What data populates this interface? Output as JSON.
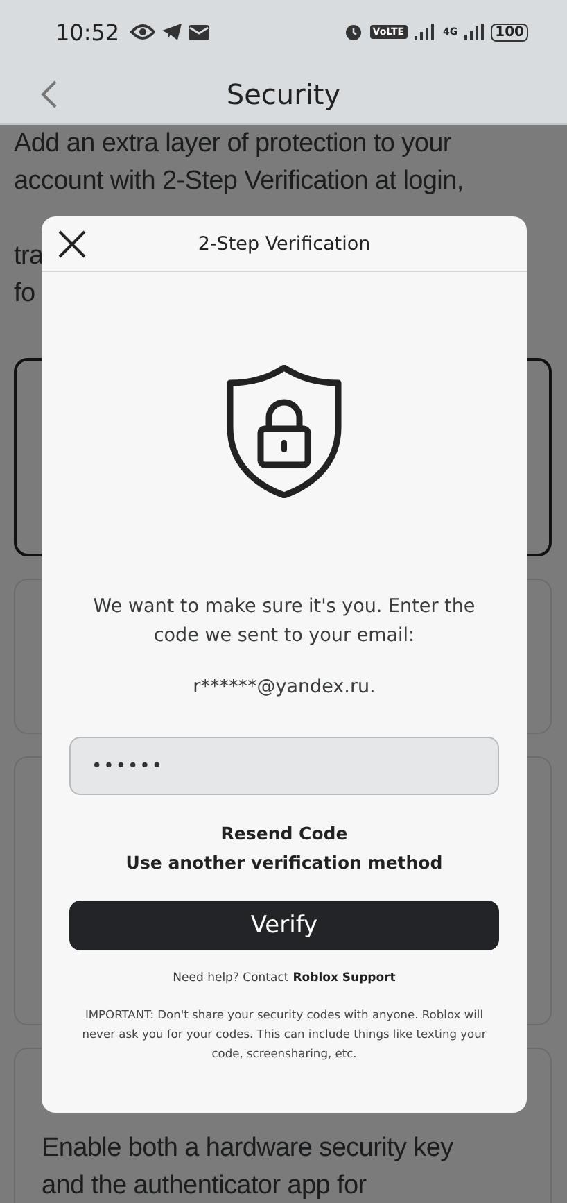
{
  "status_bar": {
    "time": "10:52",
    "volte": "VoLTE",
    "network": "4G",
    "battery": "100"
  },
  "header": {
    "title": "Security"
  },
  "page": {
    "description_lines": [
      "Add an extra layer of protection to your",
      "account with 2-Step Verification at login,"
    ],
    "covered_lines": [
      "tra",
      "fo"
    ],
    "cards": [
      {
        "selected": true
      },
      {
        "selected": false
      },
      {
        "selected": false
      },
      {
        "selected": false,
        "lines": [
          "Enable both a hardware security key",
          "and the authenticator app for"
        ]
      }
    ]
  },
  "dialog": {
    "title": "2-Step Verification",
    "message": "We want to make sure it's you. Enter the code we sent to your email:",
    "email": "r******@yandex.ru.",
    "code_value": "••••••",
    "links": [
      "Resend Code",
      "Use another verification method"
    ],
    "verify_button": "Verify",
    "help_text": "Need help? Contact",
    "help_link": "Roblox Support",
    "important": "IMPORTANT: Don't share your security codes with anyone. Roblox will never ask you for your codes. This can include things like texting your code, screensharing, etc."
  }
}
